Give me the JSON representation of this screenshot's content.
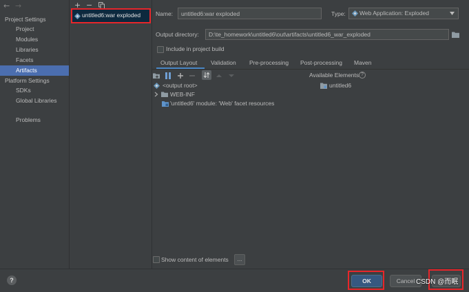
{
  "window": {
    "back_arrow": "←",
    "forward_arrow": "→"
  },
  "sidebar": {
    "project_settings_header": "Project Settings",
    "project_items": [
      {
        "label": "Project"
      },
      {
        "label": "Modules"
      },
      {
        "label": "Libraries"
      },
      {
        "label": "Facets"
      },
      {
        "label": "Artifacts",
        "selected": true
      }
    ],
    "platform_settings_header": "Platform Settings",
    "platform_items": [
      {
        "label": "SDKs"
      },
      {
        "label": "Global Libraries"
      }
    ],
    "problems_label": "Problems"
  },
  "artifacts_toolbar": {
    "add": "+",
    "remove": "−",
    "copy_icon": "copy-icon"
  },
  "artifacts_list": [
    {
      "label": "untitled6:war exploded",
      "icon": "war-exploded-icon",
      "selected": true
    }
  ],
  "form": {
    "name_label": "Name:",
    "name_value": "untitled6:war exploded",
    "type_label": "Type:",
    "type_value": "Web Application: Exploded",
    "type_icon": "web-application-icon",
    "output_dir_label": "Output directory:",
    "output_dir_value": "D:\\te_homework\\untitled6\\out\\artifacts\\untitled6_war_exploded",
    "include_build_label": "Include in project build",
    "include_build_checked": false
  },
  "tabs": [
    {
      "label": "Output Layout",
      "selected": true
    },
    {
      "label": "Validation"
    },
    {
      "label": "Pre-processing"
    },
    {
      "label": "Post-processing"
    },
    {
      "label": "Maven"
    }
  ],
  "layout_toolbar": [
    "new-folder-icon",
    "columns-icon",
    "add-icon",
    "remove-icon",
    "sort-icon",
    "move-up-icon",
    "move-down-icon"
  ],
  "output_tree": [
    {
      "label": "<output root>",
      "icon": "output-root-icon"
    },
    {
      "label": "WEB-INF",
      "icon": "folder-icon",
      "collapsed": true
    },
    {
      "label": "'untitled6' module: 'Web' facet resources",
      "icon": "module-icon"
    }
  ],
  "available_elements": {
    "title": "Available Elements",
    "help": "?",
    "items": [
      {
        "label": "untitled6",
        "icon": "folder-icon"
      }
    ]
  },
  "show_content": {
    "label": "Show content of elements",
    "checked": false,
    "more_button": "..."
  },
  "footer": {
    "help": "?",
    "ok_label": "OK",
    "cancel_label": "Cancel"
  },
  "watermark": "CSDN @而眠",
  "colors": {
    "background": "#3c3f41",
    "text": "#bbbbbb",
    "selection": "#4b6eaf",
    "list_selection": "#0d293e",
    "primary_button": "#365880",
    "annotation_red": "#e8262a"
  }
}
